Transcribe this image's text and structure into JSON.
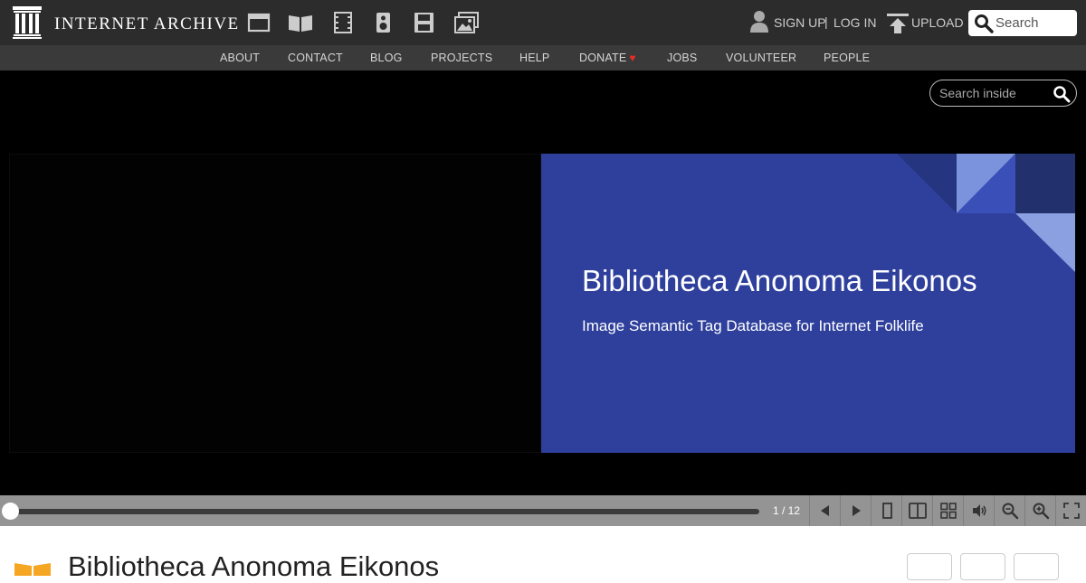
{
  "brand": {
    "name": "INTERNET ARCHIVE"
  },
  "topbar": {
    "media_icons": [
      "web-icon",
      "texts-icon",
      "video-icon",
      "audio-icon",
      "software-icon",
      "images-icon"
    ],
    "sign_up": "SIGN UP",
    "separator": "|",
    "log_in": "LOG IN",
    "upload": "UPLOAD",
    "search_placeholder": "Search"
  },
  "subnav": {
    "items": [
      "ABOUT",
      "CONTACT",
      "BLOG",
      "PROJECTS",
      "HELP",
      "DONATE",
      "JOBS",
      "VOLUNTEER",
      "PEOPLE"
    ],
    "donate_heart": "♥"
  },
  "viewer": {
    "search_inside_placeholder": "Search inside",
    "slide_title": "Bibliotheca Anonoma Eikonos",
    "slide_subtitle": "Image Semantic Tag Database for Internet Folklife"
  },
  "controls": {
    "page_indicator": "1 / 12",
    "progress": 0,
    "buttons": [
      "prev-page-icon",
      "next-page-icon",
      "one-page-view-icon",
      "two-page-view-icon",
      "thumbnail-view-icon",
      "read-aloud-icon",
      "zoom-out-icon",
      "zoom-in-icon",
      "fullscreen-icon"
    ]
  },
  "item": {
    "title": "Bibliotheca Anonoma Eikonos",
    "media_type_icon": "texts-icon"
  },
  "colors": {
    "topbar": "#2c2c2c",
    "subnav": "#3a3a3a",
    "slide_background": "#2e3f9c",
    "controls_bar": "#949494",
    "donate_heart": "#e52d27",
    "texts_icon": "#f5a623"
  }
}
